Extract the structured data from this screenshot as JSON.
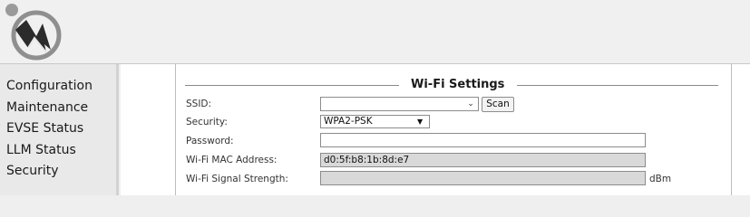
{
  "nav": {
    "items": [
      "Configuration",
      "Maintenance",
      "EVSE Status",
      "LLM Status",
      "Security"
    ]
  },
  "wifi": {
    "title": "Wi-Fi Settings",
    "ssid_label": "SSID:",
    "ssid_value": "",
    "scan_label": "Scan",
    "security_label": "Security:",
    "security_value": "WPA2-PSK",
    "password_label": "Password:",
    "password_value": "",
    "mac_label": "Wi-Fi MAC Address:",
    "mac_value": "d0:5f:b8:1b:8d:e7",
    "signal_label": "Wi-Fi Signal Strength:",
    "signal_value": "",
    "signal_unit": "dBm"
  },
  "colors": {
    "logo_gray": "#8f8f8f",
    "logo_dark": "#2b2b2b",
    "readonly_bg": "#d9d9d9"
  },
  "icons": {
    "logo": "power-plug-logo-icon",
    "ssid_dropdown": "chevron-down-icon",
    "security_dropdown": "triangle-down-icon"
  }
}
